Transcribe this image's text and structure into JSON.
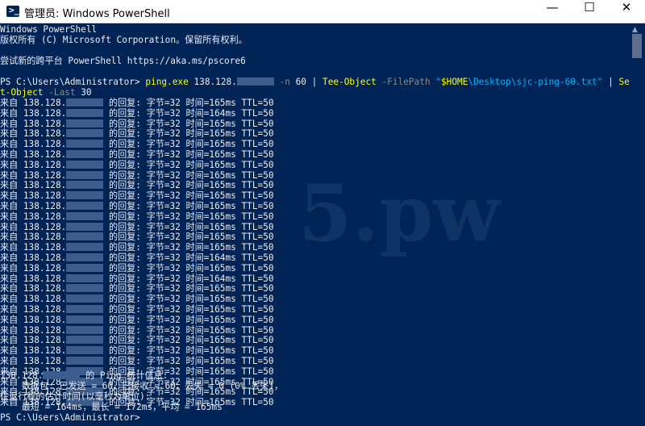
{
  "window": {
    "title": "管理员: Windows PowerShell",
    "icon": "powershell-icon",
    "minimize_glyph": "—",
    "maximize_glyph": "☐",
    "close_glyph": "✕"
  },
  "header_lines": [
    "Windows PowerShell",
    "版权所有 (C) Microsoft Corporation。保留所有权利。",
    "",
    "尝试新的跨平台 PowerShell https://aka.ms/pscore6"
  ],
  "command": {
    "prompt": "PS C:\\Users\\Administrator> ",
    "cmd1": "ping.exe",
    "ip_prefix": " 138.128.",
    "param_n": " -n",
    "n_value": " 60 ",
    "pipe1": "| ",
    "cmd2": "Tee-Object",
    "param_fp": " -FilePath ",
    "path_quote_open": "\"",
    "path_var": "$HOME",
    "path_rest": "\\Desktop\\sjc-ping-60.txt",
    "path_quote_close": "\"",
    "pipe2": " | ",
    "cmd3_part1": "Selec",
    "cmd3_part2": "t-Object",
    "param_last": " -Last",
    "last_value": " 30"
  },
  "replies": [
    {
      "prefix": "来自 138.128.",
      "suffix": " 的回复: 字节=32 时间=165ms TTL=50"
    },
    {
      "prefix": "来自 138.128.",
      "suffix": " 的回复: 字节=32 时间=164ms TTL=50"
    },
    {
      "prefix": "来自 138.128.",
      "suffix": " 的回复: 字节=32 时间=165ms TTL=50"
    },
    {
      "prefix": "来自 138.128.",
      "suffix": " 的回复: 字节=32 时间=165ms TTL=50"
    },
    {
      "prefix": "来自 138.128.",
      "suffix": " 的回复: 字节=32 时间=165ms TTL=50"
    },
    {
      "prefix": "来自 138.128.",
      "suffix": " 的回复: 字节=32 时间=165ms TTL=50"
    },
    {
      "prefix": "来自 138.128.",
      "suffix": " 的回复: 字节=32 时间=165ms TTL=50"
    },
    {
      "prefix": "来自 138.128.",
      "suffix": " 的回复: 字节=32 时间=165ms TTL=50"
    },
    {
      "prefix": "来自 138.128.",
      "suffix": " 的回复: 字节=32 时间=165ms TTL=50"
    },
    {
      "prefix": "来自 138.128.",
      "suffix": " 的回复: 字节=32 时间=165ms TTL=50"
    },
    {
      "prefix": "来自 138.128.",
      "suffix": " 的回复: 字节=32 时间=165ms TTL=50"
    },
    {
      "prefix": "来自 138.128.",
      "suffix": " 的回复: 字节=32 时间=165ms TTL=50"
    },
    {
      "prefix": "来自 138.128.",
      "suffix": " 的回复: 字节=32 时间=165ms TTL=50"
    },
    {
      "prefix": "来自 138.128.",
      "suffix": " 的回复: 字节=32 时间=165ms TTL=50"
    },
    {
      "prefix": "来自 138.128.",
      "suffix": " 的回复: 字节=32 时间=165ms TTL=50"
    },
    {
      "prefix": "来自 138.128.",
      "suffix": " 的回复: 字节=32 时间=164ms TTL=50"
    },
    {
      "prefix": "来自 138.128.",
      "suffix": " 的回复: 字节=32 时间=165ms TTL=50"
    },
    {
      "prefix": "来自 138.128.",
      "suffix": " 的回复: 字节=32 时间=164ms TTL=50"
    },
    {
      "prefix": "来自 138.128.",
      "suffix": " 的回复: 字节=32 时间=165ms TTL=50"
    },
    {
      "prefix": "来自 138.128.",
      "suffix": " 的回复: 字节=32 时间=165ms TTL=50"
    },
    {
      "prefix": "来自 138.128.",
      "suffix": " 的回复: 字节=32 时间=165ms TTL=50"
    },
    {
      "prefix": "来自 138.128.",
      "suffix": " 的回复: 字节=32 时间=165ms TTL=50"
    },
    {
      "prefix": "来自 138.128.",
      "suffix": " 的回复: 字节=32 时间=165ms TTL=50"
    },
    {
      "prefix": "来自 138.128.",
      "suffix": " 的回复: 字节=32 时间=165ms TTL=50"
    },
    {
      "prefix": "来自 138.128.",
      "suffix": " 的回复: 字节=32 时间=165ms TTL=50"
    },
    {
      "prefix": "来自 138.128.",
      "suffix": " 的回复: 字节=32 时间=165ms TTL=50"
    },
    {
      "prefix": "来自 138.128.",
      "suffix": " 的回复: 字节=32 时间=165ms TTL=50"
    },
    {
      "prefix": "来自 138.128.",
      "suffix": " 的回复: 字节=32 时间=165ms TTL=50"
    },
    {
      "prefix": "来自 138.128.",
      "suffix": " 的回复: 字节=32 时间=165ms TTL=50"
    },
    {
      "prefix": "来自 138.128.",
      "suffix": " 的回复: 字节=32 时间=165ms TTL=50"
    }
  ],
  "stats": {
    "line1_prefix": "138.128.",
    "line1_suffix": " 的 Ping 统计信息:",
    "line2": "    数据包: 已发送 = 60，已接收 = 60，丢失 = 0 (0% 丢失)，",
    "line3": "往返行程的估计时间(以毫秒为单位):",
    "line4": "    最短 = 164ms，最长 = 172ms，平均 = 165ms"
  },
  "final_prompt": "PS C:\\Users\\Administrator>",
  "watermark": "5.pw",
  "colors": {
    "background": "#012456",
    "text": "#eeedf0",
    "command": "#ffff00",
    "parameter": "#8a8a8a",
    "variable": "#00b4ff"
  }
}
